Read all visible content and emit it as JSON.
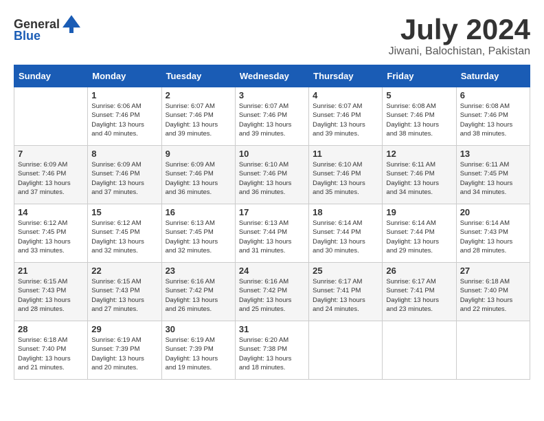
{
  "logo": {
    "general": "General",
    "blue": "Blue"
  },
  "title": {
    "month_year": "July 2024",
    "location": "Jiwani, Balochistan, Pakistan"
  },
  "headers": [
    "Sunday",
    "Monday",
    "Tuesday",
    "Wednesday",
    "Thursday",
    "Friday",
    "Saturday"
  ],
  "weeks": [
    [
      {
        "day": "",
        "info": ""
      },
      {
        "day": "1",
        "info": "Sunrise: 6:06 AM\nSunset: 7:46 PM\nDaylight: 13 hours\nand 40 minutes."
      },
      {
        "day": "2",
        "info": "Sunrise: 6:07 AM\nSunset: 7:46 PM\nDaylight: 13 hours\nand 39 minutes."
      },
      {
        "day": "3",
        "info": "Sunrise: 6:07 AM\nSunset: 7:46 PM\nDaylight: 13 hours\nand 39 minutes."
      },
      {
        "day": "4",
        "info": "Sunrise: 6:07 AM\nSunset: 7:46 PM\nDaylight: 13 hours\nand 39 minutes."
      },
      {
        "day": "5",
        "info": "Sunrise: 6:08 AM\nSunset: 7:46 PM\nDaylight: 13 hours\nand 38 minutes."
      },
      {
        "day": "6",
        "info": "Sunrise: 6:08 AM\nSunset: 7:46 PM\nDaylight: 13 hours\nand 38 minutes."
      }
    ],
    [
      {
        "day": "7",
        "info": "Sunrise: 6:09 AM\nSunset: 7:46 PM\nDaylight: 13 hours\nand 37 minutes."
      },
      {
        "day": "8",
        "info": "Sunrise: 6:09 AM\nSunset: 7:46 PM\nDaylight: 13 hours\nand 37 minutes."
      },
      {
        "day": "9",
        "info": "Sunrise: 6:09 AM\nSunset: 7:46 PM\nDaylight: 13 hours\nand 36 minutes."
      },
      {
        "day": "10",
        "info": "Sunrise: 6:10 AM\nSunset: 7:46 PM\nDaylight: 13 hours\nand 36 minutes."
      },
      {
        "day": "11",
        "info": "Sunrise: 6:10 AM\nSunset: 7:46 PM\nDaylight: 13 hours\nand 35 minutes."
      },
      {
        "day": "12",
        "info": "Sunrise: 6:11 AM\nSunset: 7:46 PM\nDaylight: 13 hours\nand 34 minutes."
      },
      {
        "day": "13",
        "info": "Sunrise: 6:11 AM\nSunset: 7:45 PM\nDaylight: 13 hours\nand 34 minutes."
      }
    ],
    [
      {
        "day": "14",
        "info": "Sunrise: 6:12 AM\nSunset: 7:45 PM\nDaylight: 13 hours\nand 33 minutes."
      },
      {
        "day": "15",
        "info": "Sunrise: 6:12 AM\nSunset: 7:45 PM\nDaylight: 13 hours\nand 32 minutes."
      },
      {
        "day": "16",
        "info": "Sunrise: 6:13 AM\nSunset: 7:45 PM\nDaylight: 13 hours\nand 32 minutes."
      },
      {
        "day": "17",
        "info": "Sunrise: 6:13 AM\nSunset: 7:44 PM\nDaylight: 13 hours\nand 31 minutes."
      },
      {
        "day": "18",
        "info": "Sunrise: 6:14 AM\nSunset: 7:44 PM\nDaylight: 13 hours\nand 30 minutes."
      },
      {
        "day": "19",
        "info": "Sunrise: 6:14 AM\nSunset: 7:44 PM\nDaylight: 13 hours\nand 29 minutes."
      },
      {
        "day": "20",
        "info": "Sunrise: 6:14 AM\nSunset: 7:43 PM\nDaylight: 13 hours\nand 28 minutes."
      }
    ],
    [
      {
        "day": "21",
        "info": "Sunrise: 6:15 AM\nSunset: 7:43 PM\nDaylight: 13 hours\nand 28 minutes."
      },
      {
        "day": "22",
        "info": "Sunrise: 6:15 AM\nSunset: 7:43 PM\nDaylight: 13 hours\nand 27 minutes."
      },
      {
        "day": "23",
        "info": "Sunrise: 6:16 AM\nSunset: 7:42 PM\nDaylight: 13 hours\nand 26 minutes."
      },
      {
        "day": "24",
        "info": "Sunrise: 6:16 AM\nSunset: 7:42 PM\nDaylight: 13 hours\nand 25 minutes."
      },
      {
        "day": "25",
        "info": "Sunrise: 6:17 AM\nSunset: 7:41 PM\nDaylight: 13 hours\nand 24 minutes."
      },
      {
        "day": "26",
        "info": "Sunrise: 6:17 AM\nSunset: 7:41 PM\nDaylight: 13 hours\nand 23 minutes."
      },
      {
        "day": "27",
        "info": "Sunrise: 6:18 AM\nSunset: 7:40 PM\nDaylight: 13 hours\nand 22 minutes."
      }
    ],
    [
      {
        "day": "28",
        "info": "Sunrise: 6:18 AM\nSunset: 7:40 PM\nDaylight: 13 hours\nand 21 minutes."
      },
      {
        "day": "29",
        "info": "Sunrise: 6:19 AM\nSunset: 7:39 PM\nDaylight: 13 hours\nand 20 minutes."
      },
      {
        "day": "30",
        "info": "Sunrise: 6:19 AM\nSunset: 7:39 PM\nDaylight: 13 hours\nand 19 minutes."
      },
      {
        "day": "31",
        "info": "Sunrise: 6:20 AM\nSunset: 7:38 PM\nDaylight: 13 hours\nand 18 minutes."
      },
      {
        "day": "",
        "info": ""
      },
      {
        "day": "",
        "info": ""
      },
      {
        "day": "",
        "info": ""
      }
    ]
  ]
}
